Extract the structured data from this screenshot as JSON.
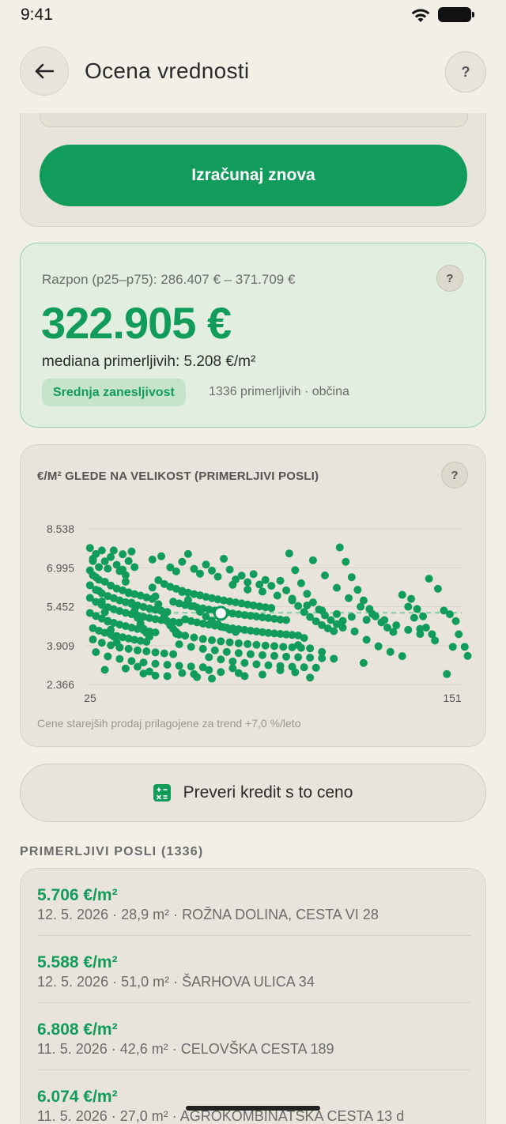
{
  "status_bar": {
    "time": "9:41"
  },
  "header": {
    "title": "Ocena vrednosti",
    "help": "?"
  },
  "recalc": {
    "label": "Izračunaj znova"
  },
  "estimate": {
    "range": "Razpon (p25–p75): 286.407 € – 371.709 €",
    "value": "322.905 €",
    "median": "mediana primerljivih: 5.208 €/m²",
    "confidence": "Srednja zanesljivost",
    "meta": "1336 primerljivih · občina",
    "help": "?"
  },
  "chart": {
    "title": "€/M² GLEDE NA VELIKOST (PRIMERLJIVI POSLI)",
    "help": "?",
    "note": "Cene starejših prodaj prilagojene za trend +7,0 %/leto"
  },
  "chart_data": {
    "type": "scatter",
    "xlabel": "",
    "ylabel": "",
    "y_ticks": [
      "8.538",
      "6.995",
      "5.452",
      "3.909",
      "2.366"
    ],
    "x_ticks": [
      "25",
      "151"
    ],
    "xlim": [
      25,
      151
    ],
    "ylim": [
      2366,
      8538
    ],
    "median_line": 5208,
    "highlight_point": {
      "x": 70,
      "y": 5190
    },
    "colors": {
      "points": "#129c5b",
      "median_line": "#7fcfa0"
    },
    "points": [
      [
        26,
        7780
      ],
      [
        27,
        7350
      ],
      [
        28,
        7540
      ],
      [
        29,
        7020
      ],
      [
        30,
        7680
      ],
      [
        31,
        7250
      ],
      [
        32,
        6960
      ],
      [
        33,
        7420
      ],
      [
        34,
        7680
      ],
      [
        35,
        7110
      ],
      [
        36,
        6860
      ],
      [
        37,
        7530
      ],
      [
        38,
        6700
      ],
      [
        39,
        7260
      ],
      [
        40,
        7640
      ],
      [
        41,
        7020
      ],
      [
        26,
        6890
      ],
      [
        27,
        6700
      ],
      [
        29,
        6520
      ],
      [
        31,
        6440
      ],
      [
        33,
        6290
      ],
      [
        35,
        6170
      ],
      [
        37,
        6100
      ],
      [
        39,
        6020
      ],
      [
        41,
        5950
      ],
      [
        43,
        5890
      ],
      [
        45,
        5820
      ],
      [
        47,
        5760
      ],
      [
        26,
        6300
      ],
      [
        28,
        6120
      ],
      [
        30,
        5980
      ],
      [
        32,
        5870
      ],
      [
        34,
        5790
      ],
      [
        36,
        5700
      ],
      [
        38,
        5630
      ],
      [
        40,
        5560
      ],
      [
        42,
        5500
      ],
      [
        44,
        5440
      ],
      [
        46,
        5380
      ],
      [
        48,
        5330
      ],
      [
        50,
        5290
      ],
      [
        52,
        5240
      ],
      [
        26,
        5800
      ],
      [
        28,
        5640
      ],
      [
        30,
        5520
      ],
      [
        32,
        5430
      ],
      [
        34,
        5350
      ],
      [
        36,
        5280
      ],
      [
        38,
        5210
      ],
      [
        40,
        5150
      ],
      [
        42,
        5100
      ],
      [
        44,
        5050
      ],
      [
        46,
        5000
      ],
      [
        48,
        4960
      ],
      [
        50,
        4920
      ],
      [
        52,
        4880
      ],
      [
        54,
        4850
      ],
      [
        56,
        4820
      ],
      [
        26,
        5200
      ],
      [
        28,
        5080
      ],
      [
        30,
        4980
      ],
      [
        32,
        4890
      ],
      [
        34,
        4810
      ],
      [
        36,
        4740
      ],
      [
        38,
        4680
      ],
      [
        40,
        4620
      ],
      [
        42,
        4570
      ],
      [
        44,
        4520
      ],
      [
        46,
        4470
      ],
      [
        48,
        4430
      ],
      [
        27,
        4600
      ],
      [
        29,
        4500
      ],
      [
        31,
        4420
      ],
      [
        33,
        4350
      ],
      [
        35,
        4290
      ],
      [
        37,
        4240
      ],
      [
        39,
        4190
      ],
      [
        41,
        4140
      ],
      [
        43,
        4100
      ],
      [
        45,
        4060
      ],
      [
        27,
        4150
      ],
      [
        30,
        4020
      ],
      [
        33,
        3920
      ],
      [
        36,
        3840
      ],
      [
        39,
        3780
      ],
      [
        42,
        3720
      ],
      [
        45,
        3680
      ],
      [
        48,
        3640
      ],
      [
        51,
        3600
      ],
      [
        54,
        3570
      ],
      [
        28,
        3650
      ],
      [
        32,
        3480
      ],
      [
        36,
        3380
      ],
      [
        40,
        3300
      ],
      [
        44,
        3240
      ],
      [
        48,
        3190
      ],
      [
        52,
        3150
      ],
      [
        56,
        3110
      ],
      [
        60,
        3080
      ],
      [
        64,
        3050
      ],
      [
        31,
        2950
      ],
      [
        38,
        3000
      ],
      [
        46,
        2880
      ],
      [
        52,
        2700
      ],
      [
        57,
        2820
      ],
      [
        61,
        2780
      ],
      [
        66,
        2940
      ],
      [
        70,
        2860
      ],
      [
        74,
        3010
      ],
      [
        78,
        2700
      ],
      [
        47,
        7320
      ],
      [
        50,
        7450
      ],
      [
        53,
        7010
      ],
      [
        55,
        6850
      ],
      [
        57,
        7230
      ],
      [
        59,
        7540
      ],
      [
        61,
        6950
      ],
      [
        63,
        6760
      ],
      [
        65,
        7120
      ],
      [
        67,
        6880
      ],
      [
        69,
        6640
      ],
      [
        71,
        7350
      ],
      [
        73,
        6920
      ],
      [
        75,
        6530
      ],
      [
        77,
        6680
      ],
      [
        79,
        6420
      ],
      [
        81,
        6740
      ],
      [
        83,
        6330
      ],
      [
        85,
        6510
      ],
      [
        87,
        6280
      ],
      [
        49,
        6500
      ],
      [
        51,
        6350
      ],
      [
        53,
        6240
      ],
      [
        55,
        6160
      ],
      [
        57,
        6080
      ],
      [
        59,
        6010
      ],
      [
        61,
        5950
      ],
      [
        63,
        5900
      ],
      [
        65,
        5840
      ],
      [
        67,
        5790
      ],
      [
        69,
        5740
      ],
      [
        71,
        5700
      ],
      [
        73,
        5660
      ],
      [
        75,
        5620
      ],
      [
        77,
        5580
      ],
      [
        79,
        5540
      ],
      [
        81,
        5500
      ],
      [
        83,
        5460
      ],
      [
        85,
        5430
      ],
      [
        87,
        5400
      ],
      [
        54,
        5650
      ],
      [
        56,
        5580
      ],
      [
        58,
        5520
      ],
      [
        60,
        5470
      ],
      [
        62,
        5420
      ],
      [
        64,
        5380
      ],
      [
        66,
        5340
      ],
      [
        68,
        5300
      ],
      [
        70,
        5260
      ],
      [
        72,
        5220
      ],
      [
        74,
        5180
      ],
      [
        76,
        5150
      ],
      [
        78,
        5120
      ],
      [
        80,
        5090
      ],
      [
        82,
        5060
      ],
      [
        84,
        5030
      ],
      [
        86,
        5000
      ],
      [
        88,
        4970
      ],
      [
        90,
        4940
      ],
      [
        92,
        4920
      ],
      [
        58,
        4950
      ],
      [
        60,
        4880
      ],
      [
        62,
        4830
      ],
      [
        64,
        4780
      ],
      [
        66,
        4740
      ],
      [
        68,
        4700
      ],
      [
        70,
        4660
      ],
      [
        72,
        4620
      ],
      [
        74,
        4590
      ],
      [
        76,
        4560
      ],
      [
        78,
        4530
      ],
      [
        80,
        4500
      ],
      [
        82,
        4470
      ],
      [
        84,
        4440
      ],
      [
        86,
        4410
      ],
      [
        88,
        4390
      ],
      [
        90,
        4370
      ],
      [
        92,
        4350
      ],
      [
        94,
        4330
      ],
      [
        96,
        4310
      ],
      [
        55,
        4380
      ],
      [
        58,
        4300
      ],
      [
        61,
        4230
      ],
      [
        64,
        4170
      ],
      [
        67,
        4120
      ],
      [
        70,
        4080
      ],
      [
        73,
        4040
      ],
      [
        76,
        4000
      ],
      [
        79,
        3970
      ],
      [
        82,
        3940
      ],
      [
        85,
        3910
      ],
      [
        88,
        3890
      ],
      [
        91,
        3860
      ],
      [
        94,
        3840
      ],
      [
        97,
        3820
      ],
      [
        100,
        3800
      ],
      [
        56,
        3960
      ],
      [
        60,
        3860
      ],
      [
        64,
        3780
      ],
      [
        68,
        3720
      ],
      [
        72,
        3660
      ],
      [
        76,
        3610
      ],
      [
        80,
        3570
      ],
      [
        84,
        3530
      ],
      [
        88,
        3500
      ],
      [
        92,
        3470
      ],
      [
        96,
        3450
      ],
      [
        100,
        3430
      ],
      [
        104,
        3410
      ],
      [
        108,
        3390
      ],
      [
        66,
        3450
      ],
      [
        70,
        3360
      ],
      [
        74,
        3280
      ],
      [
        78,
        3220
      ],
      [
        82,
        3170
      ],
      [
        86,
        3130
      ],
      [
        90,
        3100
      ],
      [
        94,
        3070
      ],
      [
        98,
        3050
      ],
      [
        102,
        3030
      ],
      [
        93,
        7560
      ],
      [
        95,
        6900
      ],
      [
        97,
        6380
      ],
      [
        99,
        5960
      ],
      [
        101,
        5620
      ],
      [
        103,
        5340
      ],
      [
        105,
        5110
      ],
      [
        107,
        4920
      ],
      [
        109,
        4760
      ],
      [
        111,
        4620
      ],
      [
        90,
        6480
      ],
      [
        92,
        6100
      ],
      [
        94,
        5770
      ],
      [
        96,
        5480
      ],
      [
        98,
        5240
      ],
      [
        100,
        5040
      ],
      [
        102,
        4870
      ],
      [
        104,
        4720
      ],
      [
        106,
        4590
      ],
      [
        108,
        4480
      ],
      [
        110,
        7800
      ],
      [
        112,
        7230
      ],
      [
        114,
        6620
      ],
      [
        116,
        6120
      ],
      [
        118,
        5700
      ],
      [
        120,
        5360
      ],
      [
        122,
        5070
      ],
      [
        124,
        4830
      ],
      [
        126,
        4620
      ],
      [
        128,
        4450
      ],
      [
        101,
        7290
      ],
      [
        105,
        6690
      ],
      [
        109,
        6200
      ],
      [
        113,
        5790
      ],
      [
        117,
        5450
      ],
      [
        121,
        5160
      ],
      [
        125,
        4920
      ],
      [
        129,
        4710
      ],
      [
        133,
        4530
      ],
      [
        137,
        4370
      ],
      [
        111,
        4890
      ],
      [
        115,
        4470
      ],
      [
        119,
        4140
      ],
      [
        123,
        3880
      ],
      [
        127,
        3660
      ],
      [
        131,
        3490
      ],
      [
        118,
        3220
      ],
      [
        104,
        3660
      ],
      [
        98,
        4210
      ],
      [
        96,
        3930
      ],
      [
        140,
        6560
      ],
      [
        143,
        6160
      ],
      [
        145,
        5300
      ],
      [
        147,
        5150
      ],
      [
        149,
        4880
      ],
      [
        150,
        4360
      ],
      [
        152,
        3860
      ],
      [
        153,
        3500
      ],
      [
        146,
        2780
      ],
      [
        148,
        3860
      ],
      [
        74,
        6320
      ],
      [
        79,
        6130
      ],
      [
        84,
        6050
      ],
      [
        89,
        5890
      ],
      [
        94,
        5700
      ],
      [
        99,
        5500
      ],
      [
        104,
        5300
      ],
      [
        109,
        5160
      ],
      [
        114,
        5050
      ],
      [
        119,
        4930
      ],
      [
        134,
        5760
      ],
      [
        136,
        5360
      ],
      [
        138,
        5070
      ],
      [
        139,
        4620
      ],
      [
        141,
        4360
      ],
      [
        142,
        4110
      ],
      [
        137,
        4570
      ],
      [
        135,
        5010
      ],
      [
        133,
        5450
      ],
      [
        131,
        5920
      ],
      [
        27,
        7260
      ],
      [
        28,
        6620
      ],
      [
        29,
        6080
      ],
      [
        30,
        5660
      ],
      [
        31,
        5230
      ],
      [
        32,
        4860
      ],
      [
        33,
        4540
      ],
      [
        34,
        4270
      ],
      [
        35,
        4030
      ],
      [
        36,
        3830
      ],
      [
        37,
        6920
      ],
      [
        38,
        6440
      ],
      [
        39,
        5990
      ],
      [
        40,
        5610
      ],
      [
        41,
        5290
      ],
      [
        42,
        5010
      ],
      [
        43,
        4780
      ],
      [
        44,
        4580
      ],
      [
        45,
        4410
      ],
      [
        46,
        4260
      ],
      [
        47,
        6210
      ],
      [
        48,
        5860
      ],
      [
        49,
        5550
      ],
      [
        50,
        5290
      ],
      [
        51,
        5060
      ],
      [
        52,
        4870
      ],
      [
        53,
        4710
      ],
      [
        54,
        4570
      ],
      [
        55,
        4450
      ],
      [
        56,
        4340
      ],
      [
        57,
        6030
      ],
      [
        59,
        5720
      ],
      [
        61,
        5470
      ],
      [
        63,
        5250
      ],
      [
        65,
        5060
      ],
      [
        67,
        4900
      ],
      [
        69,
        4760
      ],
      [
        71,
        4640
      ],
      [
        73,
        4540
      ],
      [
        75,
        4450
      ],
      [
        42,
        3070
      ],
      [
        44,
        2800
      ],
      [
        48,
        2720
      ],
      [
        62,
        2660
      ],
      [
        67,
        2600
      ],
      [
        76,
        2820
      ],
      [
        84,
        2760
      ],
      [
        90,
        2930
      ],
      [
        95,
        2850
      ],
      [
        100,
        2640
      ]
    ]
  },
  "kredit": {
    "label": "Preveri kredit s to ceno",
    "icon": "calculator-icon"
  },
  "comparables": {
    "section_title": "PRIMERLJIVI POSLI (1336)",
    "items": [
      {
        "price": "5.706 €/m²",
        "meta": "12. 5. 2026 · 28,9 m² · ROŽNA DOLINA, CESTA VI 28"
      },
      {
        "price": "5.588 €/m²",
        "meta": "12. 5. 2026 · 51,0 m² · ŠARHOVA ULICA 34"
      },
      {
        "price": "6.808 €/m²",
        "meta": "11. 5. 2026 · 42,6 m² · CELOVŠKA CESTA 189"
      },
      {
        "price": "6.074 €/m²",
        "meta": "11. 5. 2026 · 27,0 m² · AGROKOMBINATSKA CESTA 13 d"
      }
    ]
  }
}
